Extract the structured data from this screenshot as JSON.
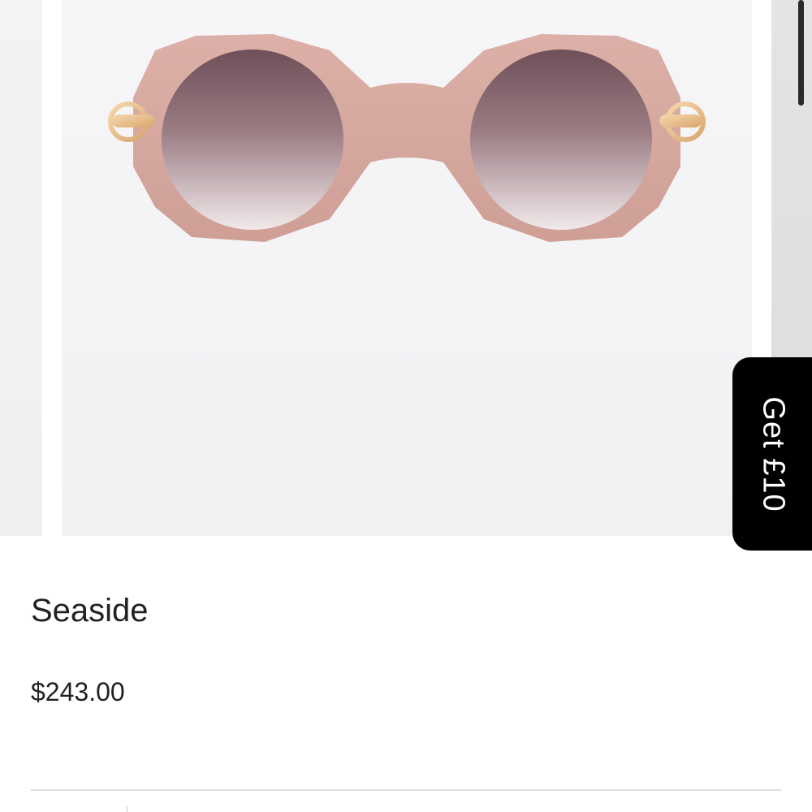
{
  "product": {
    "name": "Seaside",
    "price": "$243.00",
    "image_subject": "sunglasses",
    "frame_color": "#d6a9a0",
    "lens_color": "#7a5a62",
    "hardware_color": "#e3b784"
  },
  "promo": {
    "label": "Get £10",
    "background": "#000000"
  }
}
